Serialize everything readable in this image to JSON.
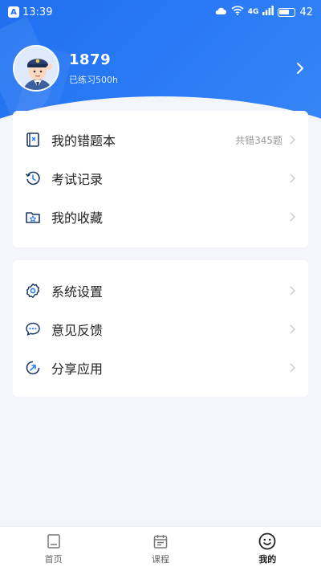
{
  "status_bar": {
    "time": "13:39",
    "app_badge": "A",
    "network": "4G",
    "battery_text": "42"
  },
  "profile": {
    "phone": "1879",
    "practice": "已练习500h"
  },
  "menu_group_1": [
    {
      "label": "我的错题本",
      "extra": "共错345题",
      "icon": "notebook-icon"
    },
    {
      "label": "考试记录",
      "extra": "",
      "icon": "history-clock-icon"
    },
    {
      "label": "我的收藏",
      "extra": "",
      "icon": "star-folder-icon"
    }
  ],
  "menu_group_2": [
    {
      "label": "系统设置",
      "icon": "gear-icon"
    },
    {
      "label": "意见反馈",
      "icon": "chat-bubble-icon"
    },
    {
      "label": "分享应用",
      "icon": "share-arrow-icon"
    }
  ],
  "tabbar": [
    {
      "label": "首页",
      "icon": "home-page-icon",
      "active": false
    },
    {
      "label": "课程",
      "icon": "calendar-icon",
      "active": false
    },
    {
      "label": "我的",
      "icon": "smiley-face-icon",
      "active": true
    }
  ],
  "colors": {
    "brand": "#1f6ff0",
    "background": "#f3f5fa",
    "muted": "#999999"
  }
}
